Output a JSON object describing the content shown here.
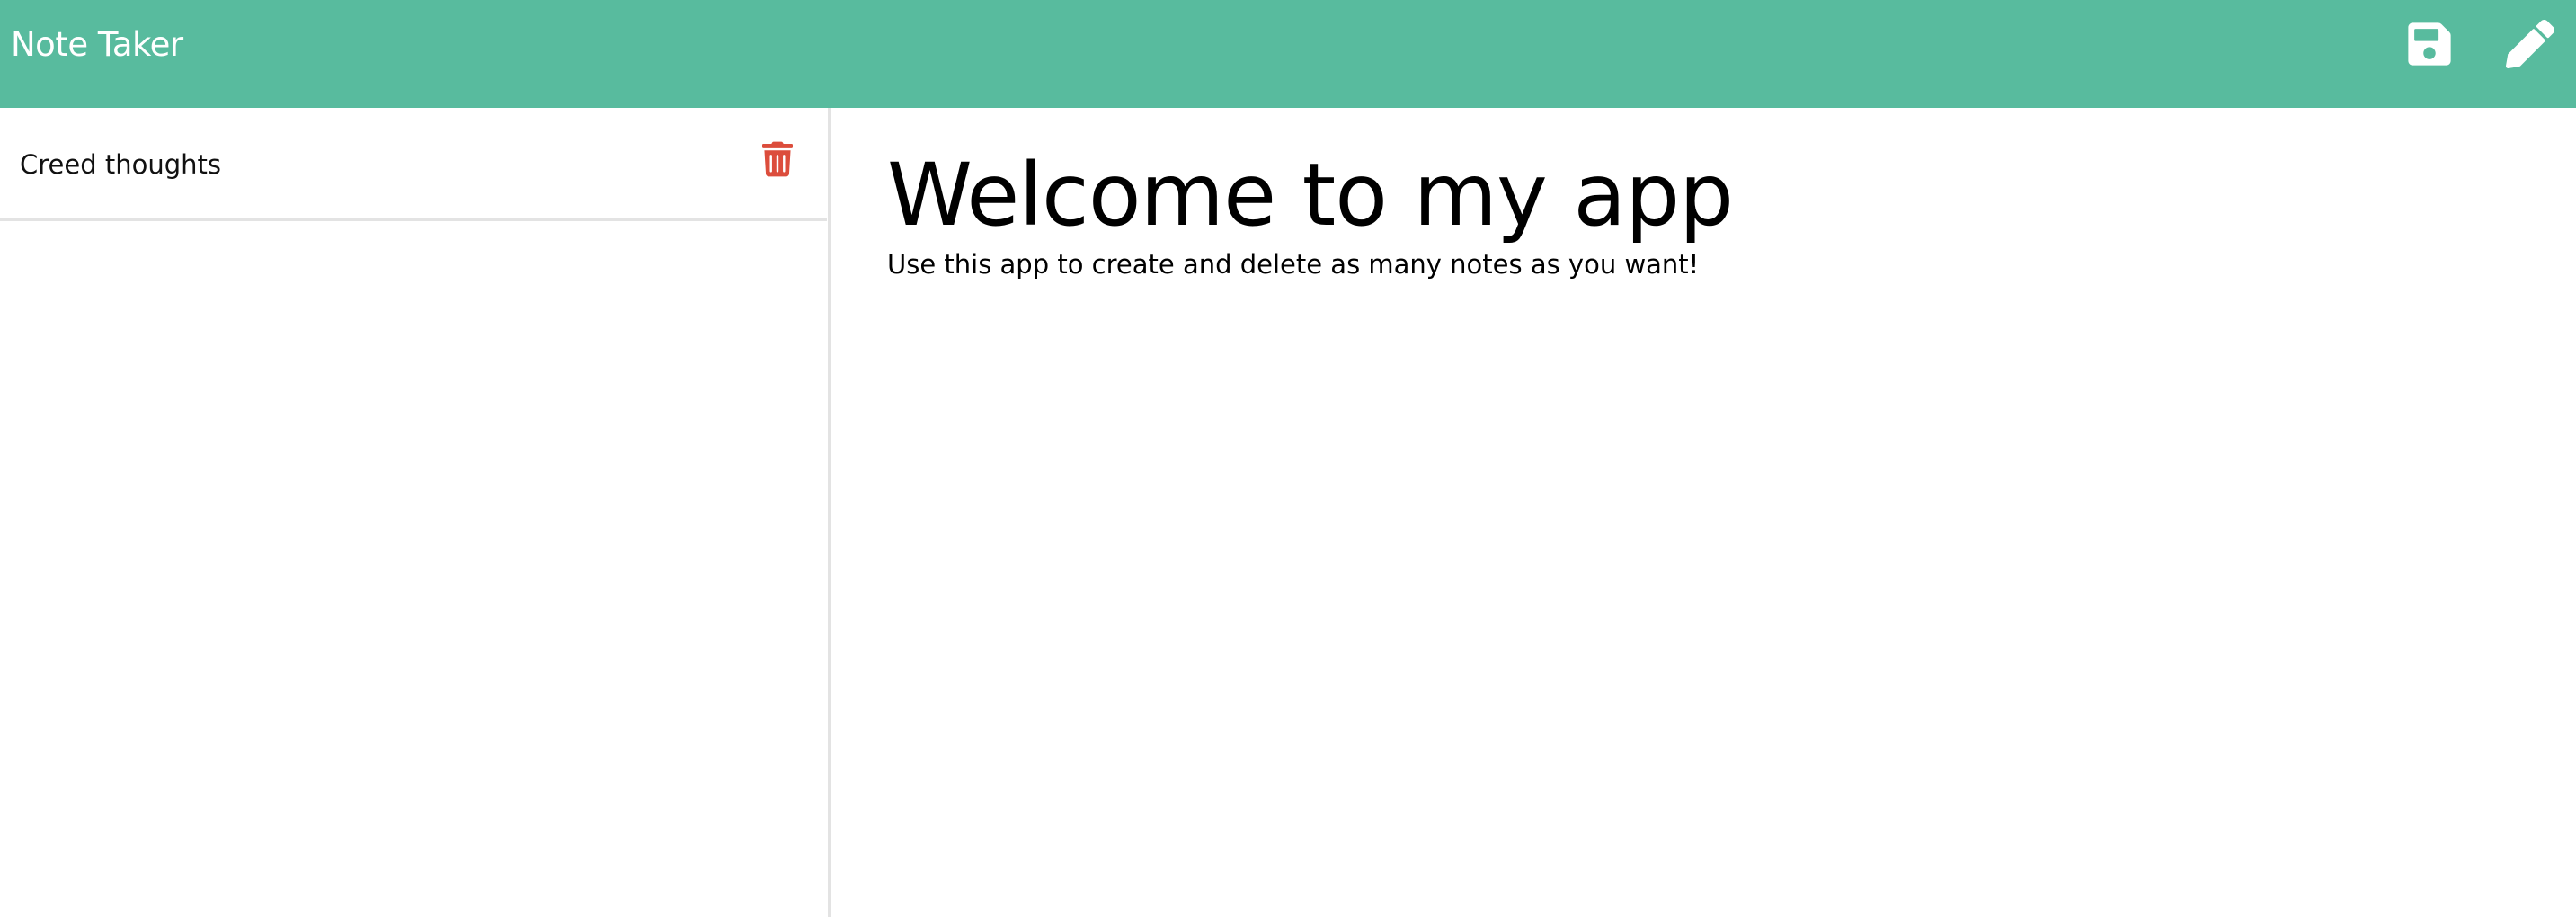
{
  "navbar": {
    "title": "Note Taker",
    "background": "#58bb9e",
    "icons": [
      "save-icon",
      "pencil-icon"
    ]
  },
  "sidebar": {
    "notes": [
      {
        "title": "Creed thoughts",
        "action_icon": "trash-icon"
      }
    ]
  },
  "main": {
    "heading": "Welcome to my app",
    "body": "Use this app to create and delete as many notes as you want!"
  },
  "colors": {
    "accent": "#58bb9e",
    "delete": "#dc4d3c",
    "divider": "#e3e3e3"
  }
}
